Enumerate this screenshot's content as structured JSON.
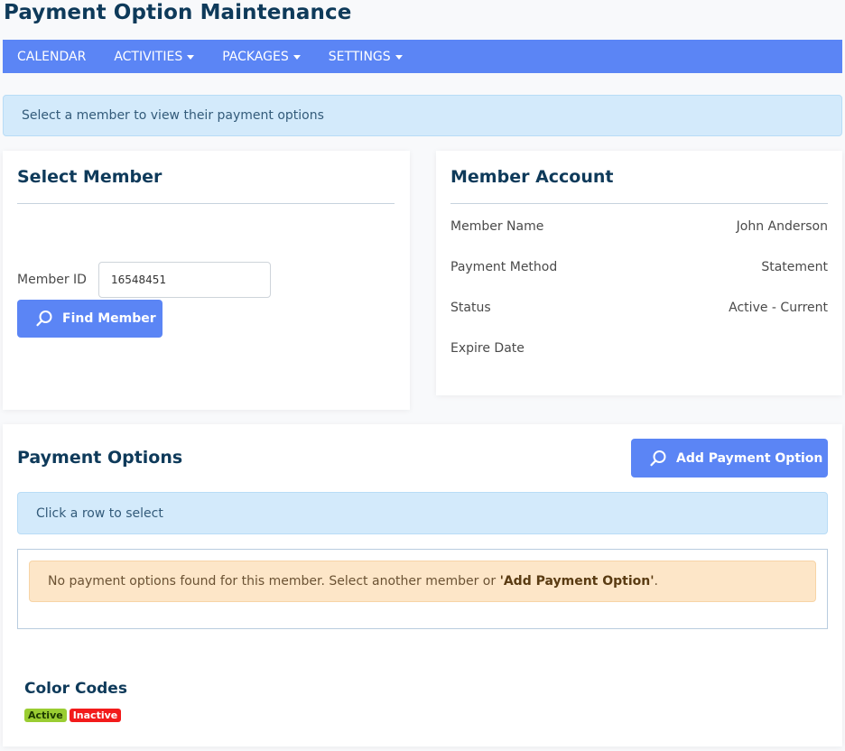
{
  "page": {
    "title": "Payment Option Maintenance"
  },
  "nav": {
    "items": [
      {
        "label": "CALENDAR",
        "dropdown": false
      },
      {
        "label": "ACTIVITIES",
        "dropdown": true
      },
      {
        "label": "PACKAGES",
        "dropdown": true
      },
      {
        "label": "SETTINGS",
        "dropdown": true
      }
    ],
    "color": "#5b85f5"
  },
  "top_alert": {
    "text": "Select a member to view their payment options"
  },
  "select_member": {
    "heading": "Select Member",
    "member_id_label": "Member ID",
    "member_id_value": "16548451",
    "find_button": "Find Member",
    "find_icon": "search-icon"
  },
  "member_account": {
    "heading": "Member Account",
    "rows": [
      {
        "label": "Member Name",
        "value": "John Anderson"
      },
      {
        "label": "Payment Method",
        "value": "Statement"
      },
      {
        "label": "Status",
        "value": "Active - Current"
      },
      {
        "label": "Expire Date",
        "value": ""
      }
    ]
  },
  "payment_options": {
    "heading": "Payment Options",
    "add_button": "Add Payment Option",
    "add_icon": "search-icon",
    "info_text": "Click a row to select",
    "empty_message_prefix": "No payment options found for this member. Select another member or ",
    "empty_message_link": "'Add Payment Option'",
    "empty_message_suffix": "."
  },
  "color_codes": {
    "heading": "Color Codes",
    "badges": [
      {
        "label": "Active",
        "color": "#9acd32"
      },
      {
        "label": "Inactive",
        "color": "#f21b1b"
      }
    ]
  }
}
